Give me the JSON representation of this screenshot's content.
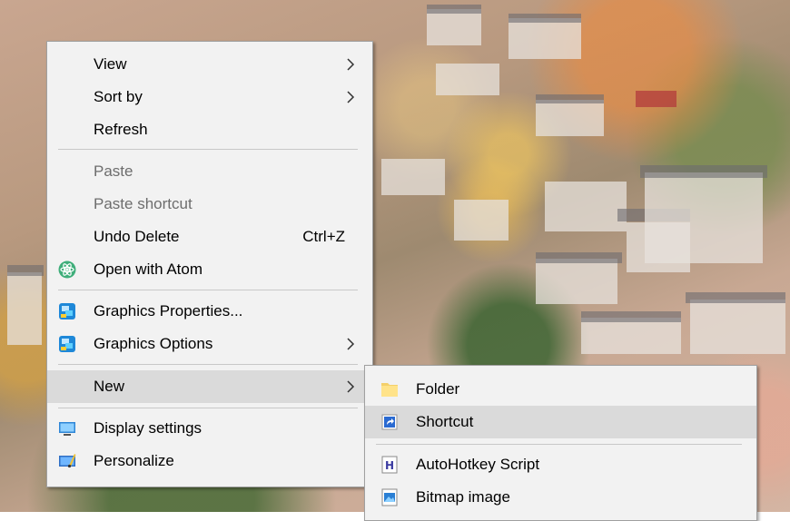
{
  "context_menu": {
    "items": [
      {
        "label": "View"
      },
      {
        "label": "Sort by"
      },
      {
        "label": "Refresh"
      },
      {
        "label": "Paste"
      },
      {
        "label": "Paste shortcut"
      },
      {
        "label": "Undo Delete",
        "shortcut": "Ctrl+Z"
      },
      {
        "label": "Open with Atom"
      },
      {
        "label": "Graphics Properties..."
      },
      {
        "label": "Graphics Options"
      },
      {
        "label": "New"
      },
      {
        "label": "Display settings"
      },
      {
        "label": "Personalize"
      }
    ]
  },
  "new_submenu": {
    "items": [
      {
        "label": "Folder"
      },
      {
        "label": "Shortcut"
      },
      {
        "label": "AutoHotkey Script"
      },
      {
        "label": "Bitmap image"
      }
    ]
  },
  "colors": {
    "menu_bg": "#f2f2f2",
    "hover_bg": "#dadada",
    "disabled_text": "#6d6d6d"
  }
}
